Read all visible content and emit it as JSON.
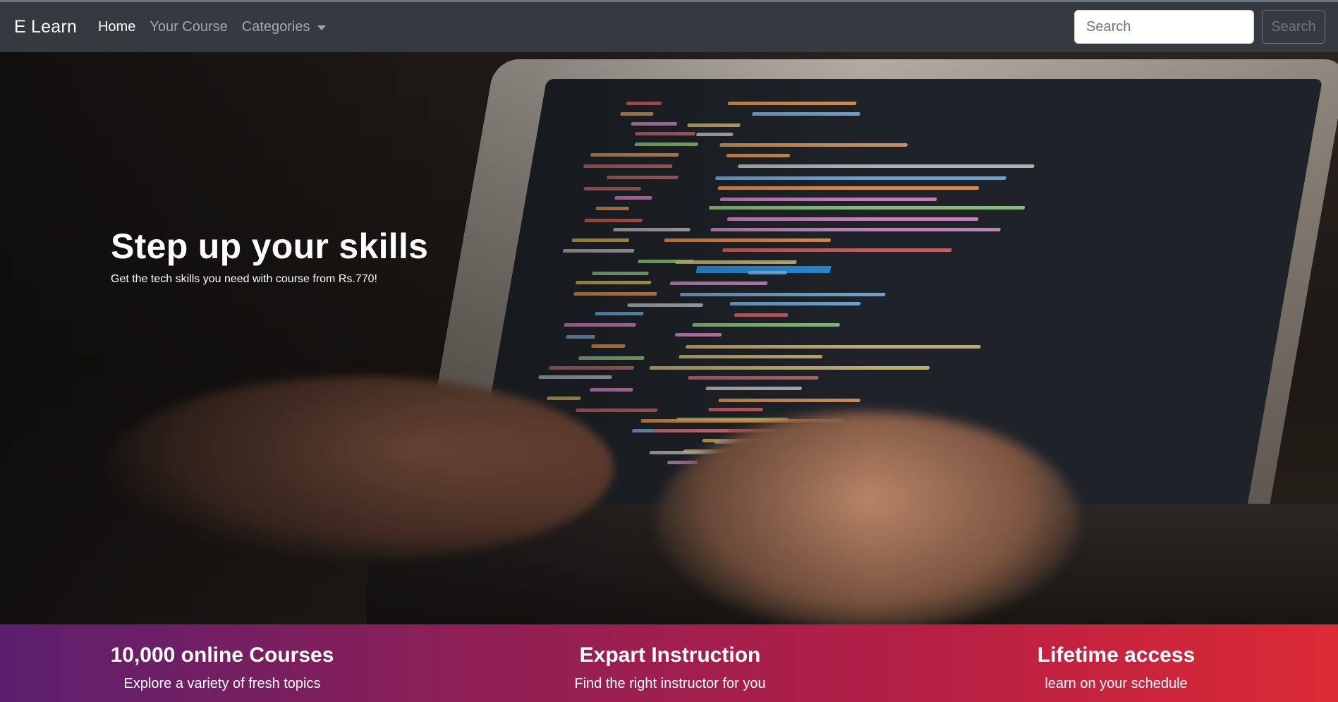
{
  "navbar": {
    "brand": "E Learn",
    "links": [
      {
        "label": "Home",
        "active": true
      },
      {
        "label": "Your Course",
        "active": false
      },
      {
        "label": "Categories",
        "active": false
      }
    ],
    "search": {
      "placeholder": "Search",
      "button_label": "Search"
    }
  },
  "hero": {
    "title": "Step up your skills",
    "subtitle": "Get the tech skills you need with course from Rs.770!"
  },
  "features": [
    {
      "title": "10,000 online Courses",
      "text": "Explore a variety of fresh topics"
    },
    {
      "title": "Expart Instruction",
      "text": "Find the right instructor for you"
    },
    {
      "title": "Lifetime access",
      "text": "learn on your schedule"
    }
  ],
  "colors": {
    "navbar_bg": "#343a40",
    "features_gradient_start": "#5b1f6e",
    "features_gradient_end": "#dc2a35"
  }
}
